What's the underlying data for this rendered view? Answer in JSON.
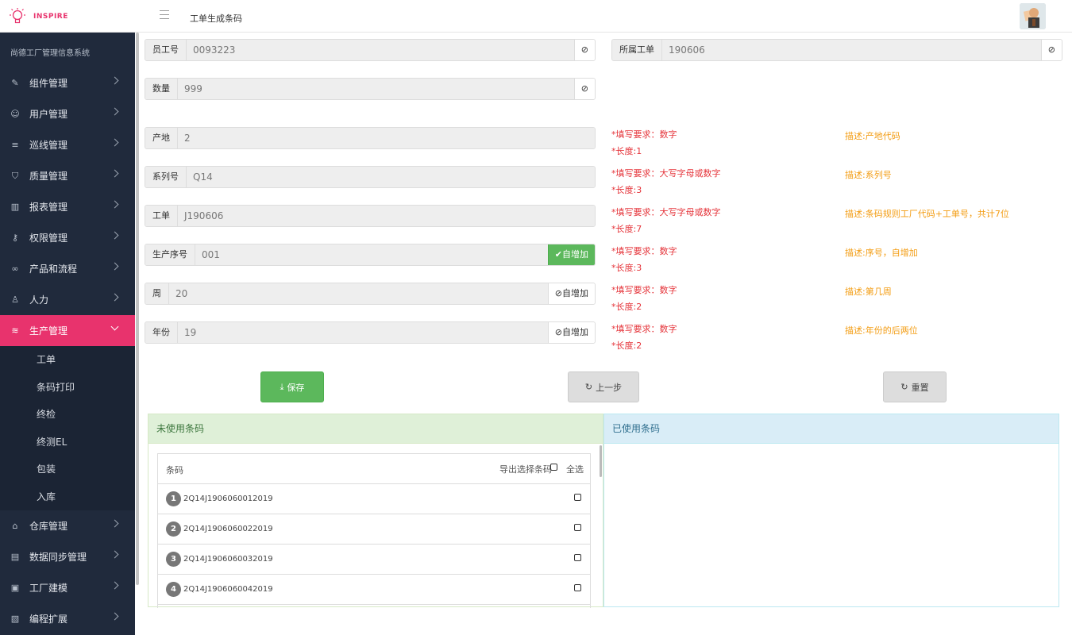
{
  "app": {
    "logo_text": "INSPIRE",
    "system_name": "尚德工厂管理信息系统"
  },
  "header": {
    "page_title": "工单生成条码"
  },
  "sidebar": {
    "items_top": [
      {
        "label": "组件管理",
        "icon": "puzzle-icon"
      },
      {
        "label": "用户管理",
        "icon": "users-icon"
      },
      {
        "label": "巡线管理",
        "icon": "list-icon"
      },
      {
        "label": "质量管理",
        "icon": "shield-icon"
      },
      {
        "label": "报表管理",
        "icon": "bar-chart-icon"
      },
      {
        "label": "权限管理",
        "icon": "key-icon"
      },
      {
        "label": "产品和流程",
        "icon": "link-icon"
      },
      {
        "label": "人力",
        "icon": "user-icon"
      }
    ],
    "active_item": {
      "label": "生产管理",
      "icon": "layers-icon"
    },
    "sub_items": [
      "工单",
      "条码打印",
      "终检",
      "终测EL",
      "包装",
      "入库"
    ],
    "items_bottom": [
      {
        "label": "仓库管理",
        "icon": "warehouse-icon"
      },
      {
        "label": "数据同步管理",
        "icon": "database-icon"
      },
      {
        "label": "工厂建模",
        "icon": "image-icon"
      },
      {
        "label": "编程扩展",
        "icon": "code-icon"
      }
    ]
  },
  "form": {
    "employee_no": {
      "label": "员工号",
      "value": "0093223"
    },
    "work_order_ref": {
      "label": "所属工单",
      "value": "190606"
    },
    "quantity": {
      "label": "数量",
      "value": "999"
    },
    "origin": {
      "label": "产地",
      "value": "2",
      "req": "*填写要求：数字",
      "len": "*长度:1",
      "desc": "描述:产地代码"
    },
    "series": {
      "label": "系列号",
      "value": "Q14",
      "req": "*填写要求：大写字母或数字",
      "len": "*长度:3",
      "desc": "描述:系列号"
    },
    "work_order": {
      "label": "工单",
      "value": "J190606",
      "req": "*填写要求：大写字母或数字",
      "len": "*长度:7",
      "desc": "描述:条码规则工厂代码+工单号，共计7位"
    },
    "serial": {
      "label": "生产序号",
      "value": "001",
      "btn": "自增加",
      "req": "*填写要求：数字",
      "len": "*长度:3",
      "desc": "描述:序号，自增加"
    },
    "week": {
      "label": "周",
      "value": "20",
      "btn": "自增加",
      "req": "*填写要求：数字",
      "len": "*长度:2",
      "desc": "描述:第几周"
    },
    "year": {
      "label": "年份",
      "value": "19",
      "btn": "自增加",
      "req": "*填写要求：数字",
      "len": "*长度:2",
      "desc": "描述:年份的后两位"
    }
  },
  "actions": {
    "save": "保存",
    "prev": "上一步",
    "reset": "重置"
  },
  "unused_panel": {
    "title": "未使用条码",
    "col_code": "条码",
    "export_label": "导出选择条码",
    "select_all": "全选",
    "rows": [
      {
        "no": "1",
        "code": "2Q14J1906060012019"
      },
      {
        "no": "2",
        "code": "2Q14J1906060022019"
      },
      {
        "no": "3",
        "code": "2Q14J1906060032019"
      },
      {
        "no": "4",
        "code": "2Q14J1906060042019"
      }
    ]
  },
  "used_panel": {
    "title": "已使用条码"
  },
  "colors": {
    "accent": "#e8336d",
    "sidebar": "#202a3c",
    "success": "#5cb85c",
    "required": "#e5343a",
    "desc": "#f39c12"
  }
}
